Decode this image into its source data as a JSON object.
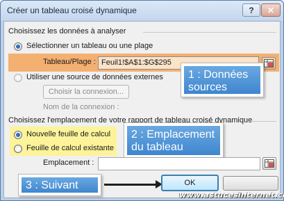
{
  "window": {
    "title": "Créer un tableau croisé dynamique",
    "help_label": "?",
    "close_label": "✕"
  },
  "section_data": {
    "heading": "Choisissez les données à analyser",
    "option_range": "Sélectionner un tableau ou une plage",
    "range_label": "Tableau/Plage :",
    "range_value": "Feuil1!$A$1:$G$295",
    "option_external": "Utiliser une source de données externes",
    "choose_connection": "Choisir la connexion...",
    "connection_name_label": "Nom de la connexion :"
  },
  "section_location": {
    "heading": "Choisissez l'emplacement de votre rapport de tableau croisé dynamique",
    "option_new_sheet": "Nouvelle feuille de calcul",
    "option_existing_sheet": "Feuille de calcul existante",
    "location_label": "Emplacement :",
    "location_value": ""
  },
  "callouts": {
    "c1_line1": "1 : Données",
    "c1_line2": "sources",
    "c2_line1": "2 : Emplacement",
    "c2_line2": "du tableau",
    "c3": "3 : Suivant"
  },
  "buttons": {
    "ok": "OK"
  },
  "watermark": "www.astucesinternet.com",
  "colors": {
    "callout_blue": "#4a90d9",
    "highlight_orange": "#f5a55a",
    "highlight_yellow": "#fcf39a"
  }
}
